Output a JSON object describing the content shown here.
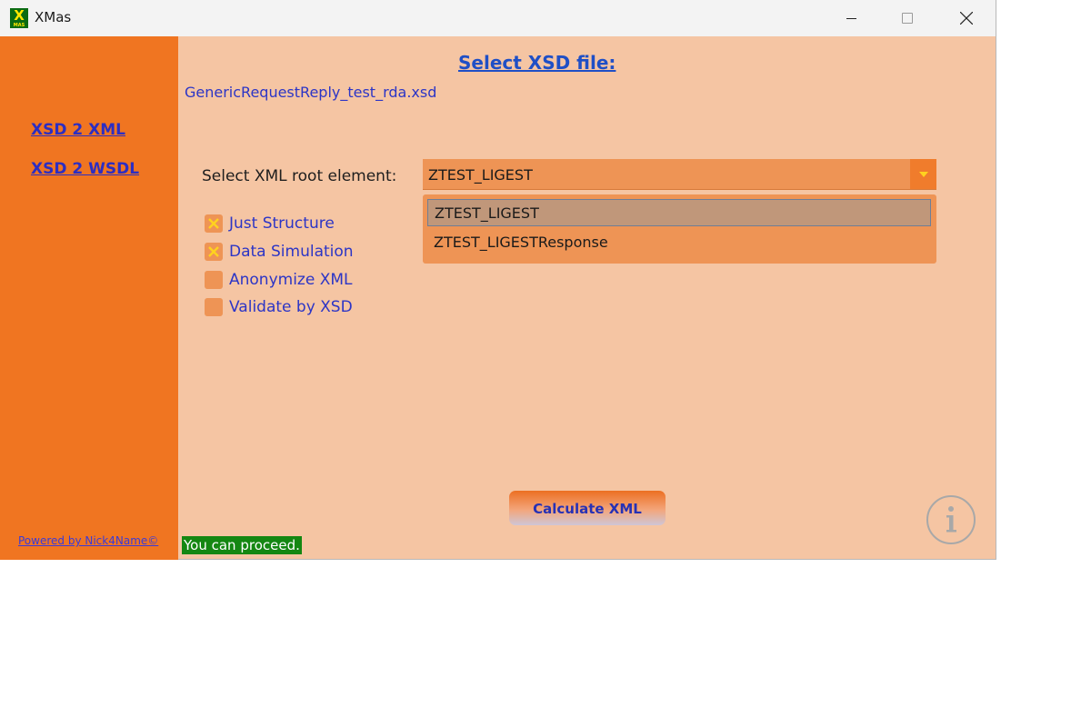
{
  "window": {
    "title": "XMas",
    "app_icon_letter": "X",
    "app_icon_caption": "MAS"
  },
  "sidebar": {
    "links": [
      {
        "label": "XSD 2 XML"
      },
      {
        "label": "XSD 2 WSDL"
      }
    ],
    "powered_by": "Powered by Nick4Name©"
  },
  "main": {
    "heading": "Select XSD file:",
    "file_name": "GenericRequestReply_test_rda.xsd",
    "root_element_label": "Select XML root element:",
    "root_element_value": "ZTEST_LIGEST",
    "dropdown_options": [
      {
        "label": "ZTEST_LIGEST",
        "selected": true
      },
      {
        "label": "ZTEST_LIGESTResponse",
        "selected": false
      }
    ],
    "options": [
      {
        "label": "Just Structure",
        "checked": true
      },
      {
        "label": "Data Simulation",
        "checked": true
      },
      {
        "label": "Anonymize XML",
        "checked": false
      },
      {
        "label": "Validate by XSD",
        "checked": false
      }
    ],
    "calculate_label": "Calculate XML",
    "info_icon": "info-icon",
    "status": "You can proceed."
  },
  "colors": {
    "sidebar": "#f07521",
    "content": "#f5c5a3",
    "accent": "#ee9455",
    "link": "#2c35c6",
    "status_bg": "#148712"
  }
}
